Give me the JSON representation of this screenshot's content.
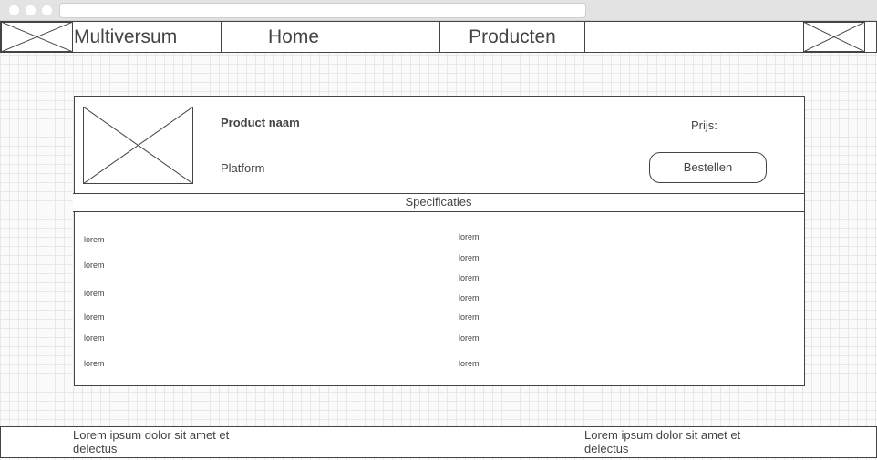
{
  "nav": {
    "title": "Multiversum",
    "home_label": "Home",
    "products_label": "Producten"
  },
  "product": {
    "name": "Product naam",
    "platform": "Platform",
    "price_label": "Prijs:",
    "order_label": "Bestellen"
  },
  "specs": {
    "header": "Specificaties",
    "left": [
      "lorem",
      "lorem",
      "lorem",
      "lorem",
      "lorem",
      "lorem"
    ],
    "right": [
      "lorem",
      "lorem",
      "lorem",
      "lorem",
      "lorem",
      "lorem",
      "lorem"
    ]
  },
  "footer": {
    "left_text": "Lorem ipsum dolor sit amet et delectus",
    "right_text": "Lorem ipsum dolor sit amet et delectus"
  },
  "colors": {
    "line": "#444444",
    "grid": "#e8e8e8"
  }
}
